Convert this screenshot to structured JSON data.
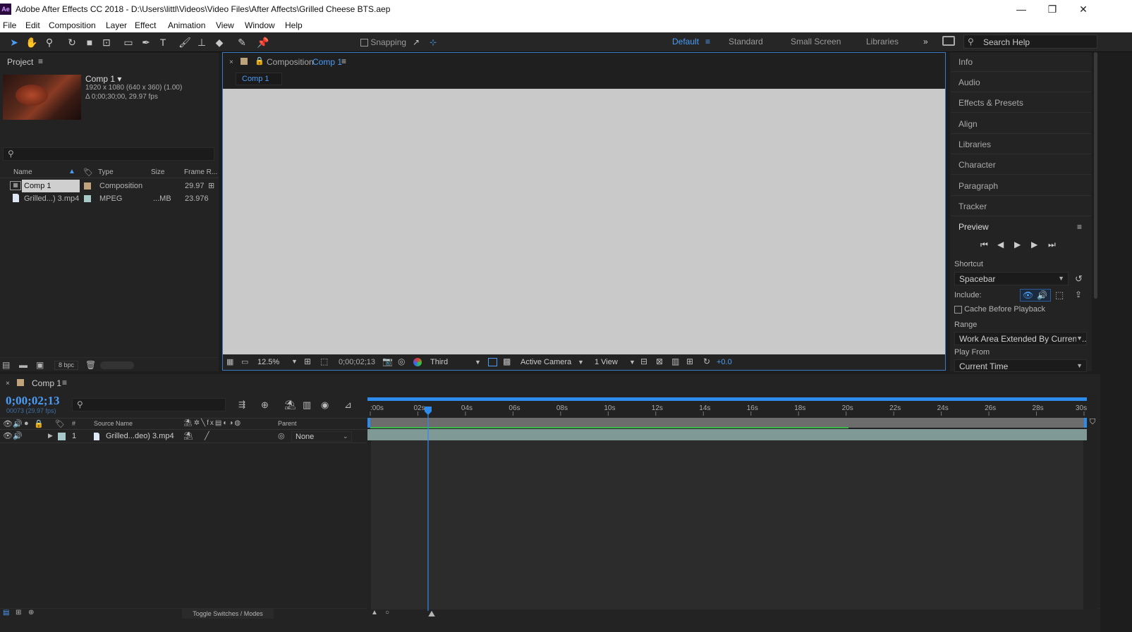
{
  "window": {
    "logo": "Ae",
    "title": "Adobe After Effects CC 2018 - D:\\Users\\littl\\Videos\\Video Files\\After Affects\\Grilled Cheese BTS.aep",
    "minimize": "—",
    "restore": "❐",
    "close": "✕"
  },
  "menu": [
    "File",
    "Edit",
    "Composition",
    "Layer",
    "Effect",
    "Animation",
    "View",
    "Window",
    "Help"
  ],
  "toolbar": {
    "snapping_label": "Snapping",
    "workspaces": [
      "Default",
      "Standard",
      "Small Screen",
      "Libraries"
    ],
    "search_placeholder": "Search Help"
  },
  "project": {
    "title": "Project",
    "comp_name": "Comp 1 ▾",
    "comp_size": "1920 x 1080  (640 x 360) (1.00)",
    "comp_duration": "Δ 0;00;30;00, 29.97 fps",
    "columns": [
      "Name",
      "Type",
      "Size",
      "Frame R..."
    ],
    "items": [
      {
        "name": "Comp 1",
        "type": "Composition",
        "size": "",
        "fps": "29.97"
      },
      {
        "name": "Grilled...) 3.mp4",
        "type": "MPEG",
        "size": "...MB",
        "fps": "23.976"
      }
    ],
    "bpc": "8 bpc"
  },
  "composition": {
    "panel_label": "Composition",
    "comp_name": "Comp 1",
    "tab": "Comp 1",
    "zoom": "12.5%",
    "timecode": "0;00;02;13",
    "resolution": "Third",
    "camera": "Active Camera",
    "views": "1 View",
    "exposure": "+0.0"
  },
  "right_panels": [
    "Info",
    "Audio",
    "Effects & Presets",
    "Align",
    "Libraries",
    "Character",
    "Paragraph",
    "Tracker"
  ],
  "preview": {
    "title": "Preview",
    "shortcut_label": "Shortcut",
    "shortcut_value": "Spacebar",
    "include_label": "Include:",
    "cache_label": "Cache Before Playback",
    "range_label": "Range",
    "range_value": "Work Area Extended By Current...",
    "play_from_label": "Play From",
    "play_from_value": "Current Time"
  },
  "timeline": {
    "tab": "Comp 1",
    "timecode": "0;00;02;13",
    "frame_info": "00073 (29.97 fps)",
    "ticks": [
      ":00s",
      "02s",
      "04s",
      "06s",
      "08s",
      "10s",
      "12s",
      "14s",
      "16s",
      "18s",
      "20s",
      "22s",
      "24s",
      "26s",
      "28s",
      "30s"
    ],
    "playhead_seconds": 2.43,
    "duration_seconds": 30,
    "columns": {
      "num": "#",
      "source": "Source Name",
      "parent": "Parent"
    },
    "layers": [
      {
        "num": "1",
        "name": "Grilled...deo) 3.mp4",
        "parent": "None"
      }
    ],
    "toggle_label": "Toggle Switches / Modes"
  },
  "colors": {
    "accent": "#2d8ceb",
    "viewer": "#c9c9c9",
    "comp_label": "#bfa37a",
    "layer_bar": "#7f9a96",
    "work_area": "#6c6c6c"
  }
}
